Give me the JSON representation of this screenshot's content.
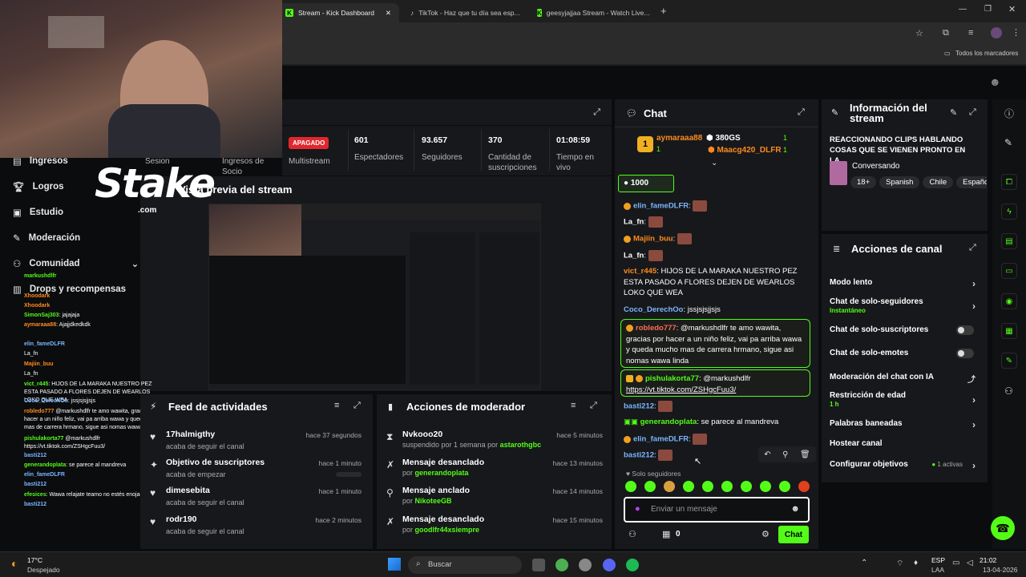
{
  "browser": {
    "tabs": [
      {
        "label": "Stream - Kick Dashboard",
        "icon": "kick-icon"
      },
      {
        "label": "TikTok - Haz que tu día sea esp...",
        "icon": "tiktok-icon"
      },
      {
        "label": "geesyjajjaa Stream - Watch Live...",
        "icon": "kick-icon"
      }
    ],
    "bookmarks_label": "Todos los marcadores"
  },
  "stream": {
    "status_badge": "APAGADO",
    "multistream_label": "Multistream",
    "stats": [
      {
        "value": "601",
        "label": "Espectadores"
      },
      {
        "value": "93.657",
        "label": "Seguidores"
      },
      {
        "value": "370",
        "label": "Cantidad de suscripciones"
      },
      {
        "value": "01:08:59",
        "label": "Tiempo en vivo"
      }
    ],
    "preview_title": "Vista previa del stream",
    "sesion_label": "Sesion",
    "ingresos_socio_label": "Ingresos de Socio"
  },
  "leftnav": {
    "items": [
      {
        "label": "Ingresos",
        "icon": "dollar-icon"
      },
      {
        "label": "Logros",
        "icon": "trophy-icon"
      },
      {
        "label": "Estudio",
        "icon": "studio-icon"
      },
      {
        "label": "Moderación",
        "icon": "wrench-icon"
      },
      {
        "label": "Comunidad",
        "icon": "community-icon"
      },
      {
        "label": "Drops y recompensas",
        "icon": "gift-icon"
      }
    ]
  },
  "overlay": {
    "brand": "Stake",
    "brand_sub": ".com",
    "chat_lines": [
      {
        "user": "markushdlfr",
        "text": ""
      },
      {
        "user": "Xhoodark",
        "text": ""
      },
      {
        "user": "Xhoodark",
        "text": ""
      },
      {
        "user": "SimonSaj303",
        "text": "jajajaja"
      },
      {
        "user": "aymaraaa88",
        "text": "Ajajjdkedkdk"
      },
      {
        "user": "elin_fameDLFR",
        "text": ""
      },
      {
        "user": "La_fn",
        "text": ""
      },
      {
        "user": "Majiin_buu",
        "text": ""
      },
      {
        "user": "La_fn",
        "text": ""
      },
      {
        "user": "vict_r445",
        "text": "HIJOS DE LA MARAKA NUESTRO PEZ ESTA PASADO A FLORES DEJEN DE WEARLOS LOKO QUE WEA"
      },
      {
        "user": "Coco_DerechOo",
        "text": "jssjsjsjjsjs"
      },
      {
        "user": "robledo777",
        "text": "@markushdlfr te amo wawita, gracias por hacer a un niño feliz, vai pa arriba wawa y queda mucho mas de carrera hrmano, sigue asi nomas wawa linda"
      },
      {
        "user": "pishulakorta77",
        "text": "@markushdlfr https://vt.tiktok.com/ZSHgcFuu3/"
      },
      {
        "user": "basti212",
        "text": ""
      },
      {
        "user": "generandoplata",
        "text": "se parece al mandreva"
      },
      {
        "user": "elin_fameDLFR",
        "text": ""
      },
      {
        "user": "basti212",
        "text": ""
      },
      {
        "user": "efesices",
        "text": "Wawa relajate teamo no estés enojado"
      },
      {
        "user": "basti212",
        "text": ""
      }
    ]
  },
  "activity_feed": {
    "title": "Feed de actividades",
    "items": [
      {
        "title": "17halmigthy",
        "sub": "acaba de seguir el canal",
        "time": "hace 37 segundos",
        "icon": "heart-icon"
      },
      {
        "title": "Objetivo de suscriptores",
        "sub": "acaba de empezar",
        "time": "hace 1 minuto",
        "icon": "sparkle-icon"
      },
      {
        "title": "dimesebita",
        "sub": "acaba de seguir el canal",
        "time": "hace 1 minuto",
        "icon": "heart-icon"
      },
      {
        "title": "rodr190",
        "sub": "acaba de seguir el canal",
        "time": "hace 2 minutos",
        "icon": "heart-icon"
      }
    ]
  },
  "mod_actions": {
    "title": "Acciones de moderador",
    "items": [
      {
        "title": "Nvkooo20",
        "sub": "suspendido por 1 semana por",
        "by": "astarothgbc",
        "time": "hace 5 minutos",
        "icon": "hourglass-icon"
      },
      {
        "title": "Mensaje desanclado",
        "sub": "por",
        "by": "generandoplata",
        "time": "hace 13 minutos",
        "icon": "unpin-icon"
      },
      {
        "title": "Mensaje anclado",
        "sub": "por",
        "by": "NikoteeGB",
        "time": "hace 14 minutos",
        "icon": "pin-icon"
      },
      {
        "title": "Mensaje desanclado",
        "sub": "por",
        "by": "goodlfr44xsiempre",
        "time": "hace 15 minutos",
        "icon": "unpin-icon"
      }
    ]
  },
  "chat": {
    "title": "Chat",
    "top_gifter": {
      "rank": "1",
      "user": "aymaraaa88",
      "count": "1"
    },
    "gifts": {
      "amount": "380GS",
      "count1": "1",
      "user2": "Maacg420_DLFR",
      "count2": "1"
    },
    "kicks_amount": "1000",
    "messages": [
      {
        "user": "elin_fameDLFR",
        "text": ""
      },
      {
        "user": "La_fn",
        "text": ""
      },
      {
        "user": "Majiin_buu",
        "text": ""
      },
      {
        "user": "La_fn",
        "text": ""
      },
      {
        "user": "vict_r445",
        "text": "HIJOS DE LA MARAKA NUESTRO PEZ ESTA PASADO A FLORES DEJEN DE WEARLOS LOKO QUE WEA"
      },
      {
        "user": "Coco_DerechOo",
        "text": "jssjsjsjjsjs"
      },
      {
        "user": "robledo777",
        "text": "@markushdlfr te amo wawita, gracias por hacer a un niño feliz, vai pa arriba wawa y queda mucho mas de carrera hrmano, sigue asi nomas wawa linda"
      },
      {
        "user": "pishulakorta77",
        "text": "@markushdlfr",
        "link": "https://vt.tiktok.com/ZSHgcFuu3/"
      },
      {
        "user": "basti212",
        "text": ""
      },
      {
        "user": "generandoplata",
        "text": "se parece al mandreva"
      },
      {
        "user": "elin_fameDLFR",
        "text": ""
      },
      {
        "user": "basti212",
        "text": ""
      }
    ],
    "mode_label": "Solo seguidores",
    "input_placeholder": "Enviar un mensaje",
    "viewer_count": "0",
    "send_label": "Chat"
  },
  "stream_info": {
    "title": "Información del stream",
    "stream_title": "REACCIONANDO CLIPS HABLANDO COSAS QUE SE VIENEN PRONTO EN LA...",
    "category": "Conversando",
    "tags": [
      "18+",
      "Spanish",
      "Chile",
      "Españo"
    ]
  },
  "channel_actions": {
    "title": "Acciones de canal",
    "items": [
      {
        "label": "Modo lento",
        "sub": "",
        "control": "chevron"
      },
      {
        "label": "Chat de solo-seguidores",
        "sub": "Instantáneo",
        "control": "chevron"
      },
      {
        "label": "Chat de solo-suscriptores",
        "sub": "",
        "control": "toggle"
      },
      {
        "label": "Chat de solo-emotes",
        "sub": "",
        "control": "toggle"
      },
      {
        "label": "Moderación del chat con IA",
        "sub": "",
        "control": "external"
      },
      {
        "label": "Restricción de edad",
        "sub": "1 h",
        "control": "chevron"
      },
      {
        "label": "Palabras baneadas",
        "sub": "",
        "control": "chevron"
      },
      {
        "label": "Hostear canal",
        "sub": "",
        "control": "none"
      },
      {
        "label": "Configurar objetivos",
        "sub": "",
        "control": "chevron",
        "status": "1 activas"
      }
    ]
  },
  "taskbar": {
    "weather_temp": "17°C",
    "weather_desc": "Despejado",
    "search_placeholder": "Buscar",
    "lang": "ESP",
    "lang_sub": "LAA",
    "time": "21:02",
    "date": "13-04-2026"
  },
  "colors": {
    "accent": "#53fc18",
    "panel": "#17181b",
    "bg": "#0b0c0e",
    "alert": "#e0282e"
  }
}
